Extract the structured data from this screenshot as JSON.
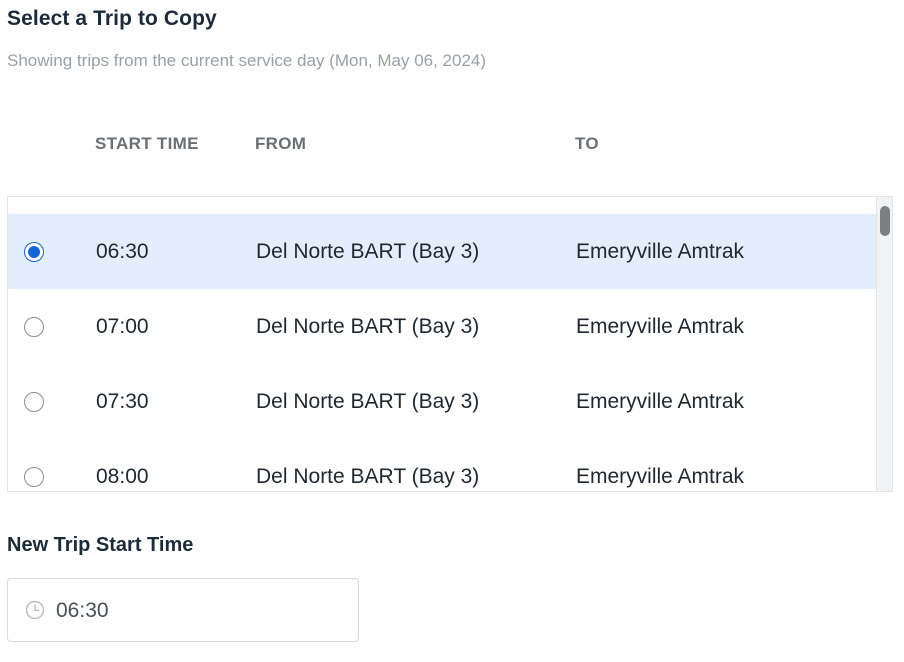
{
  "header": {
    "title": "Select a Trip to Copy",
    "subtitle": "Showing trips from the current service day (Mon, May 06, 2024)"
  },
  "table": {
    "columns": {
      "start_time": "START TIME",
      "from": "FROM",
      "to": "TO"
    },
    "rows": [
      {
        "start_time": "06:30",
        "from": "Del Norte BART (Bay 3)",
        "to": "Emeryville Amtrak",
        "selected": true
      },
      {
        "start_time": "07:00",
        "from": "Del Norte BART (Bay 3)",
        "to": "Emeryville Amtrak",
        "selected": false
      },
      {
        "start_time": "07:30",
        "from": "Del Norte BART (Bay 3)",
        "to": "Emeryville Amtrak",
        "selected": false
      },
      {
        "start_time": "08:00",
        "from": "Del Norte BART (Bay 3)",
        "to": "Emeryville Amtrak",
        "selected": false
      }
    ]
  },
  "new_trip": {
    "label": "New Trip Start Time",
    "value": "06:30",
    "icon": "clock-icon"
  },
  "colors": {
    "accent": "#1565d8",
    "selected_row": "#e3eefc"
  }
}
